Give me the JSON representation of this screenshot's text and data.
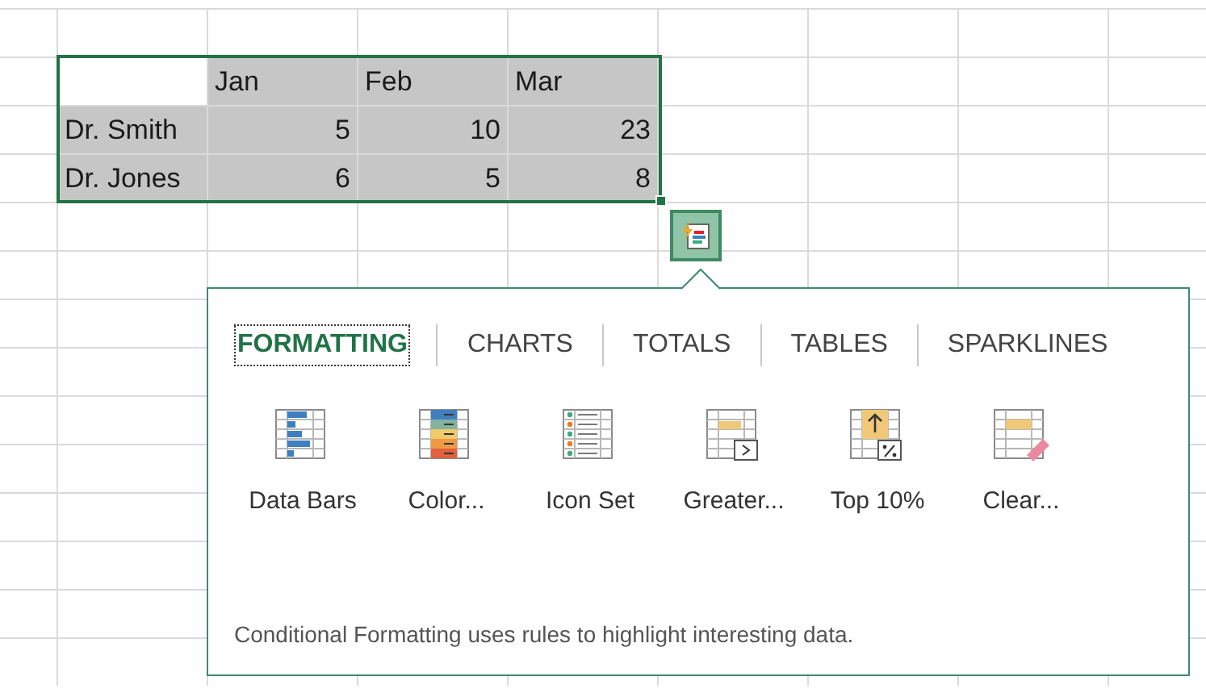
{
  "table": {
    "columns": [
      "Jan",
      "Feb",
      "Mar"
    ],
    "rows": [
      {
        "label": "Dr. Smith",
        "values": [
          "5",
          "10",
          "23"
        ]
      },
      {
        "label": "Dr. Jones",
        "values": [
          "6",
          "5",
          "8"
        ]
      }
    ]
  },
  "quick_analysis": {
    "tabs": [
      {
        "label": "FORMATTING",
        "selected": true
      },
      {
        "label": "CHARTS",
        "selected": false
      },
      {
        "label": "TOTALS",
        "selected": false
      },
      {
        "label": "TABLES",
        "selected": false
      },
      {
        "label": "SPARKLINES",
        "selected": false
      }
    ],
    "options": [
      {
        "kind": "databars",
        "label": "Data Bars"
      },
      {
        "kind": "colorscale",
        "label": "Color..."
      },
      {
        "kind": "iconset",
        "label": "Icon Set"
      },
      {
        "kind": "greater",
        "label": "Greater..."
      },
      {
        "kind": "top",
        "label": "Top 10%"
      },
      {
        "kind": "clear",
        "label": "Clear..."
      }
    ],
    "description": "Conditional Formatting uses rules to highlight interesting data."
  }
}
